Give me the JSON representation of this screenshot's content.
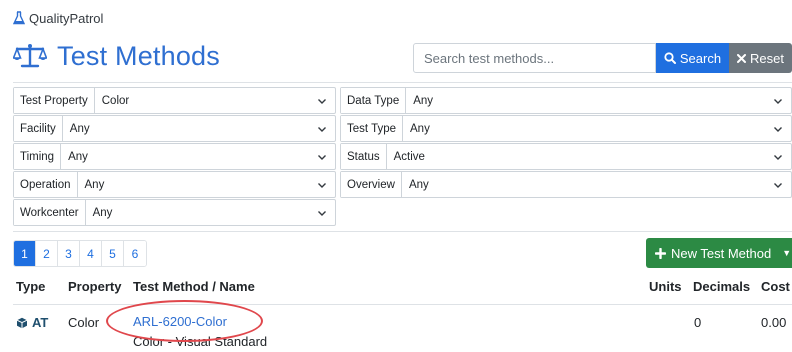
{
  "brand": {
    "name": "QualityPatrol",
    "icon": "flask-icon",
    "icon_color": "#2f6fd1"
  },
  "page": {
    "title": "Test Methods",
    "icon": "scale-icon",
    "accent": "#2f6fd1"
  },
  "search": {
    "placeholder": "Search test methods...",
    "value": "",
    "search_label": "Search",
    "reset_label": "Reset"
  },
  "filters": {
    "test_property": {
      "label": "Test Property",
      "value": "Color"
    },
    "data_type": {
      "label": "Data Type",
      "value": "Any"
    },
    "facility": {
      "label": "Facility",
      "value": "Any"
    },
    "test_type": {
      "label": "Test Type",
      "value": "Any"
    },
    "timing": {
      "label": "Timing",
      "value": "Any"
    },
    "status": {
      "label": "Status",
      "value": "Active"
    },
    "operation": {
      "label": "Operation",
      "value": "Any"
    },
    "overview": {
      "label": "Overview",
      "value": "Any"
    },
    "workcenter": {
      "label": "Workcenter",
      "value": "Any"
    }
  },
  "pagination": {
    "pages": [
      "1",
      "2",
      "3",
      "4",
      "5",
      "6"
    ],
    "current": "1"
  },
  "new_button": {
    "label": "New Test Method"
  },
  "table": {
    "headers": {
      "type": "Type",
      "property": "Property",
      "method": "Test Method / Name",
      "units": "Units",
      "decimals": "Decimals",
      "cost": "Cost"
    },
    "rows": [
      {
        "type": "AT",
        "property": "Color",
        "method": "ARL-6200-Color",
        "name": "Color - Visual Standard",
        "units": "",
        "decimals": "0",
        "cost": "0.00"
      }
    ]
  },
  "colors": {
    "primary": "#1f6fe0",
    "success": "#2c8a44",
    "secondary": "#6c757d",
    "highlight": "#e0474c"
  }
}
